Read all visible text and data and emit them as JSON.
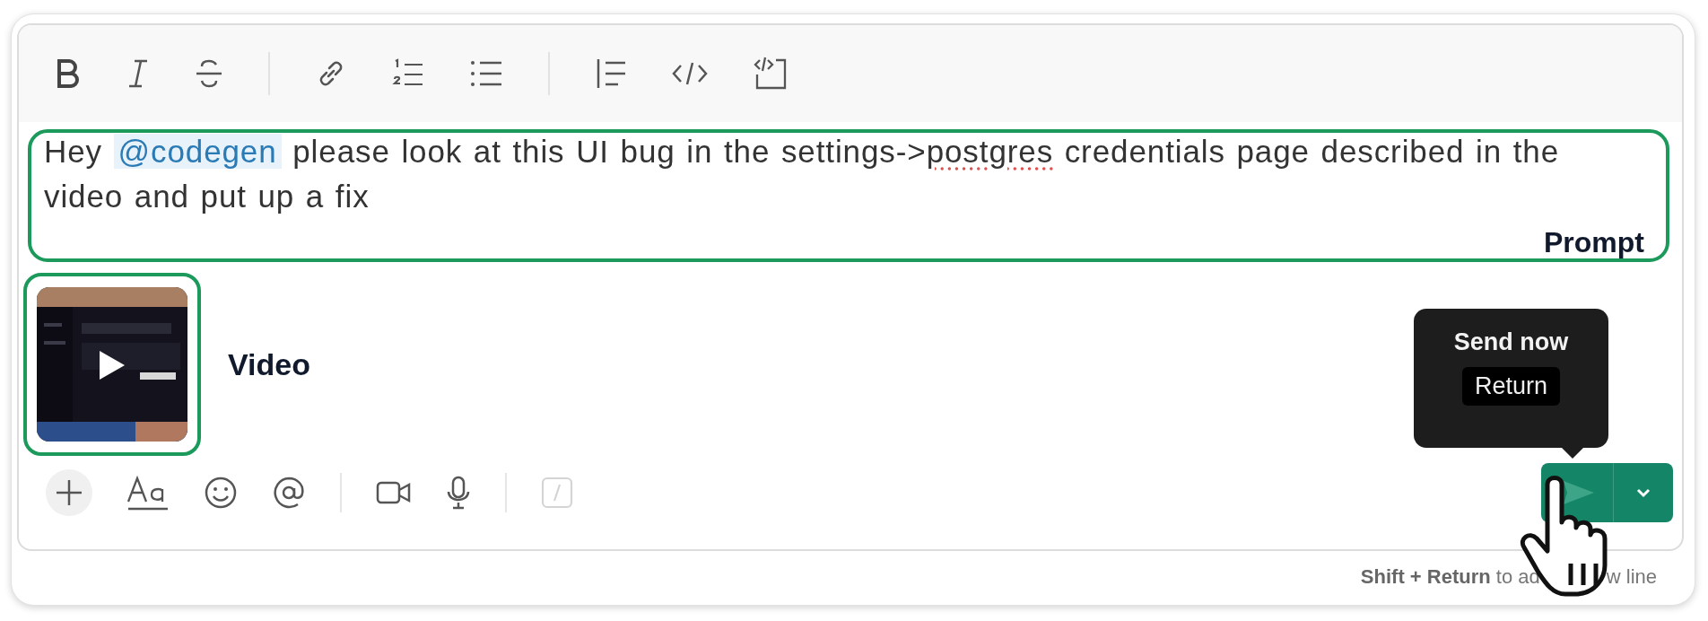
{
  "message": {
    "segments": [
      {
        "kind": "text",
        "text": "Hey "
      },
      {
        "kind": "mention",
        "text": "@codegen"
      },
      {
        "kind": "text",
        "text": " please look at this UI bug in the settings->"
      },
      {
        "kind": "misspelled",
        "text": "postgres"
      },
      {
        "kind": "text",
        "text": " credentials page described in the video and put up a fix"
      }
    ]
  },
  "annotations": {
    "prompt": "Prompt",
    "video": "Video"
  },
  "tooltip": {
    "title": "Send now",
    "shortcut": "Return"
  },
  "hint": {
    "visible_parts": [
      "**Shift + Return** to ad",
      "w line"
    ]
  }
}
